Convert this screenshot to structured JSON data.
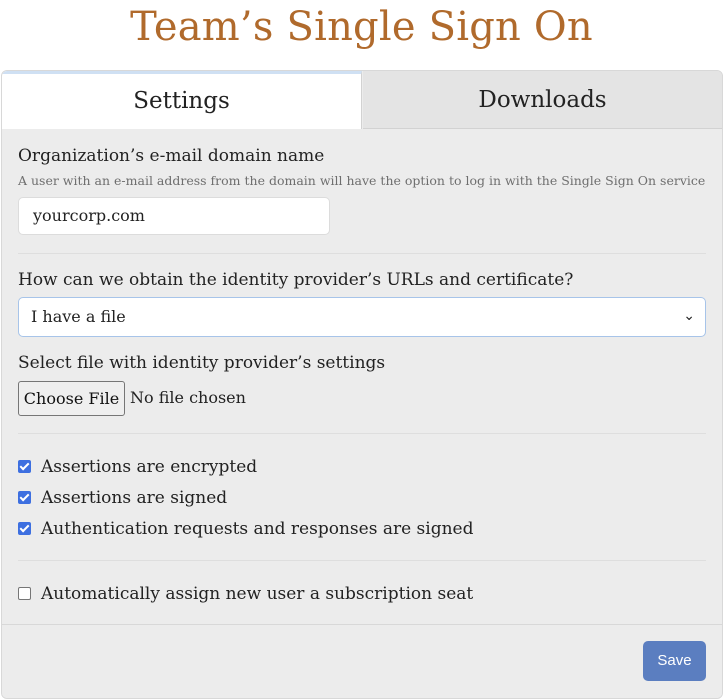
{
  "title": "Team’s Single Sign On",
  "tabs": [
    {
      "label": "Settings",
      "active": true
    },
    {
      "label": "Downloads",
      "active": false
    }
  ],
  "domain": {
    "label": "Organization’s e-mail domain name",
    "help": "A user with an e-mail address from the domain will have the option to log in with the Single Sign On service",
    "value": "yourcorp.com"
  },
  "provider": {
    "label": "How can we obtain the identity provider’s URLs and certificate?",
    "selected": "I have a file"
  },
  "file": {
    "label": "Select file with identity provider’s settings",
    "button": "Choose File",
    "status": "No file chosen"
  },
  "checks": [
    {
      "label": "Assertions are encrypted",
      "checked": true
    },
    {
      "label": "Assertions are signed",
      "checked": true
    },
    {
      "label": "Authentication requests and responses are signed",
      "checked": true
    }
  ],
  "seat": {
    "label": "Automatically assign new user a subscription seat",
    "checked": false
  },
  "save_label": "Save",
  "colors": {
    "title": "#b06a2c",
    "accent": "#5b7ec0",
    "checkbox": "#3d6fe0"
  }
}
